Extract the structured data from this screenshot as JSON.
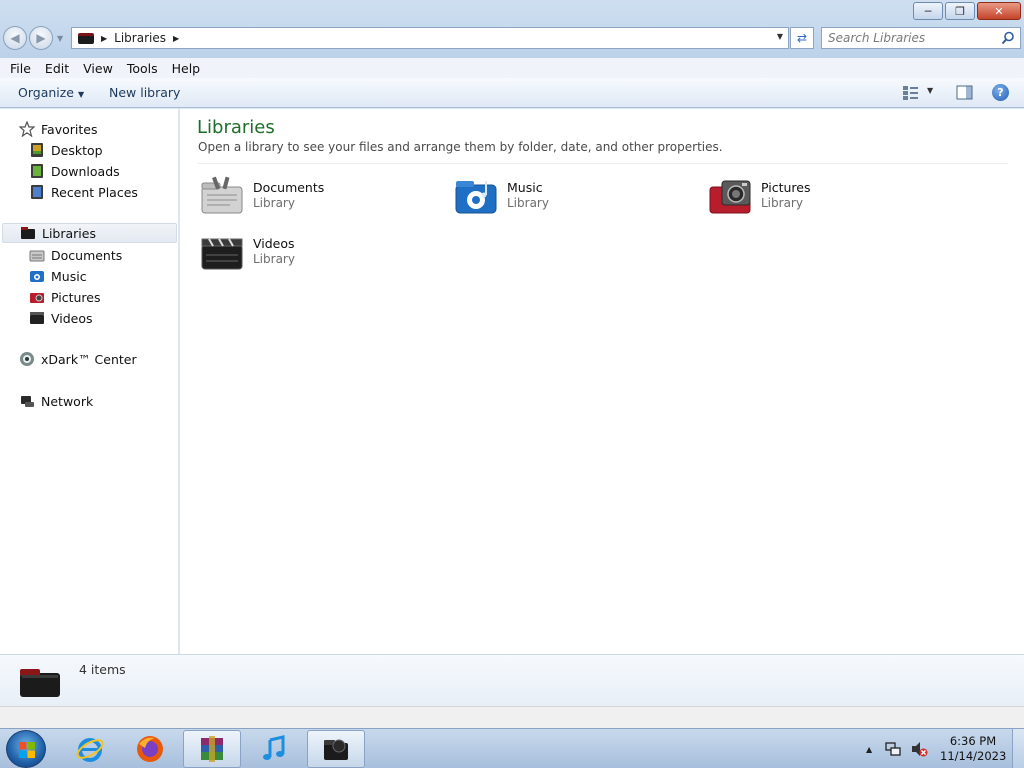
{
  "window": {
    "minimize_icon": "minimize-icon",
    "maximize_icon": "restore-icon",
    "close_icon": "close-icon"
  },
  "address": {
    "crumb": "Libraries",
    "search_placeholder": "Search Libraries"
  },
  "menu": [
    "File",
    "Edit",
    "View",
    "Tools",
    "Help"
  ],
  "toolbar": {
    "organize": "Organize",
    "new_library": "New library"
  },
  "sidebar": {
    "favorites": {
      "label": "Favorites",
      "items": [
        "Desktop",
        "Downloads",
        "Recent Places"
      ]
    },
    "libraries": {
      "label": "Libraries",
      "items": [
        "Documents",
        "Music",
        "Pictures",
        "Videos"
      ]
    },
    "xdark": "xDark™ Center",
    "network": "Network"
  },
  "content": {
    "title": "Libraries",
    "subtitle": "Open a library to see your files and arrange them by folder, date, and other properties.",
    "libraries": [
      {
        "name": "Documents",
        "type": "Library"
      },
      {
        "name": "Music",
        "type": "Library"
      },
      {
        "name": "Pictures",
        "type": "Library"
      },
      {
        "name": "Videos",
        "type": "Library"
      }
    ]
  },
  "details": {
    "count": "4 items"
  },
  "taskbar": {
    "time": "6:36 PM",
    "date": "11/14/2023"
  },
  "colors": {
    "title_green": "#1e6e2a",
    "accent_blue": "#1f5fb3",
    "pictures_red": "#b81d2c"
  }
}
